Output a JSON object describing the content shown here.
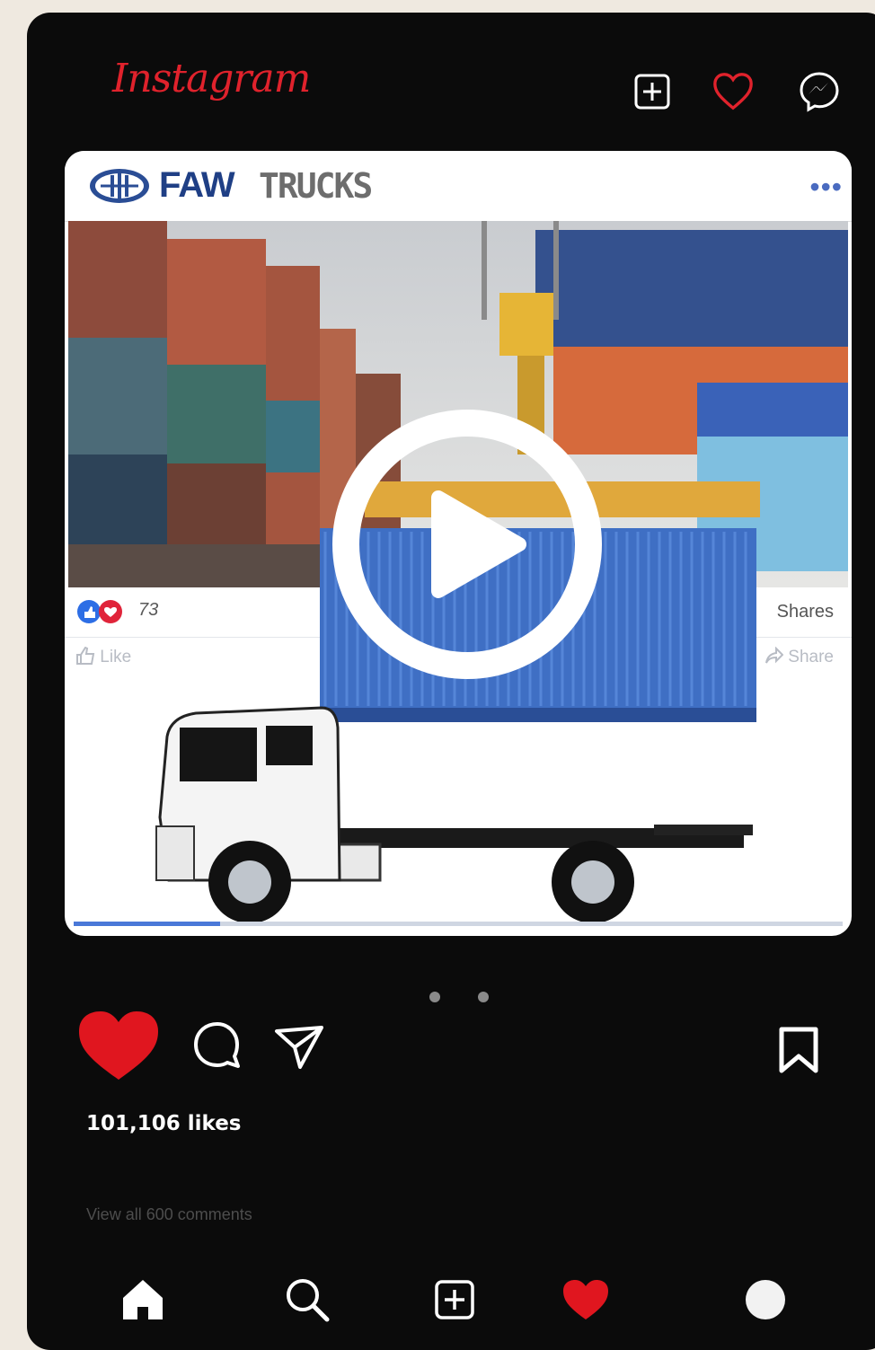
{
  "header": {
    "brand": "Instagram",
    "icons": [
      "add-post-icon",
      "heart-outline-icon",
      "messenger-icon"
    ],
    "brand_color": "#e0222c"
  },
  "post": {
    "logo": {
      "brand_left": "FAW",
      "brand_right": "TRUCKS"
    },
    "more_label": "•••",
    "embedded_post": {
      "reaction_count": "73",
      "shares_label": "Shares",
      "like_label": "Like",
      "share_label": "Share"
    },
    "video_progress": 0.19,
    "carousel": {
      "count": 2
    }
  },
  "actions": {
    "likes": "101,106 likes",
    "comments_link": "View all 600 comments"
  },
  "bottom_nav": [
    "home-icon",
    "search-icon",
    "add-post-icon",
    "heart-icon",
    "profile-avatar"
  ]
}
